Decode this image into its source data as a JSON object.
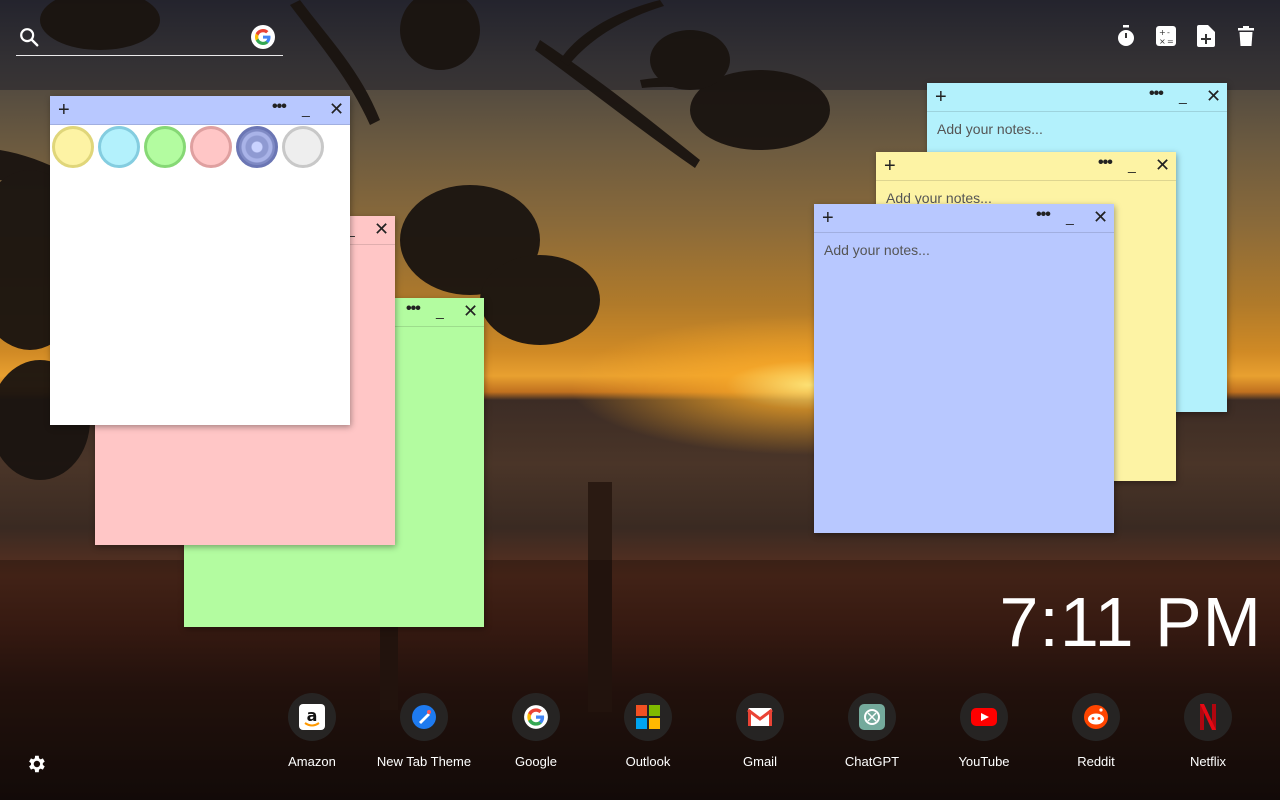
{
  "search": {
    "placeholder": ""
  },
  "top_tools": [
    {
      "name": "timer-icon"
    },
    {
      "name": "calculator-icon"
    },
    {
      "name": "new-note-icon"
    },
    {
      "name": "trash-icon"
    }
  ],
  "notes": [
    {
      "id": "white",
      "color": "#ffffff",
      "placeholder": ""
    },
    {
      "id": "pink",
      "color": "#ffc6c6",
      "placeholder": ""
    },
    {
      "id": "green",
      "color": "#b3fca0",
      "placeholder": ""
    },
    {
      "id": "cyan",
      "color": "#b3f1fc",
      "placeholder": "Add your notes..."
    },
    {
      "id": "yellow",
      "color": "#fdf3a4",
      "placeholder": "Add your notes..."
    },
    {
      "id": "blue",
      "color": "#b8c8ff",
      "placeholder": "Add your notes..."
    }
  ],
  "note_controls": {
    "plus": "+",
    "more": "•••",
    "minimize": "_",
    "close": "✕"
  },
  "color_swatches": [
    {
      "fill": "#fdf3a4",
      "ring": "#e0d67a"
    },
    {
      "fill": "#b3f1fc",
      "ring": "#84cde0"
    },
    {
      "fill": "#b3fca0",
      "ring": "#86d875"
    },
    {
      "fill": "#ffc6c6",
      "ring": "#dfa0a0"
    },
    {
      "fill": "#8f9ad2",
      "ring": "#6b76b4"
    },
    {
      "fill": "#eeeeee",
      "ring": "#c8c8c8"
    }
  ],
  "clock": "7:11 PM",
  "apps": [
    {
      "label": "Amazon",
      "icon": "amazon-icon"
    },
    {
      "label": "New Tab Theme",
      "icon": "new-tab-theme-icon"
    },
    {
      "label": "Google",
      "icon": "google-icon"
    },
    {
      "label": "Outlook",
      "icon": "outlook-icon"
    },
    {
      "label": "Gmail",
      "icon": "gmail-icon"
    },
    {
      "label": "ChatGPT",
      "icon": "chatgpt-icon"
    },
    {
      "label": "YouTube",
      "icon": "youtube-icon"
    },
    {
      "label": "Reddit",
      "icon": "reddit-icon"
    },
    {
      "label": "Netflix",
      "icon": "netflix-icon"
    }
  ]
}
